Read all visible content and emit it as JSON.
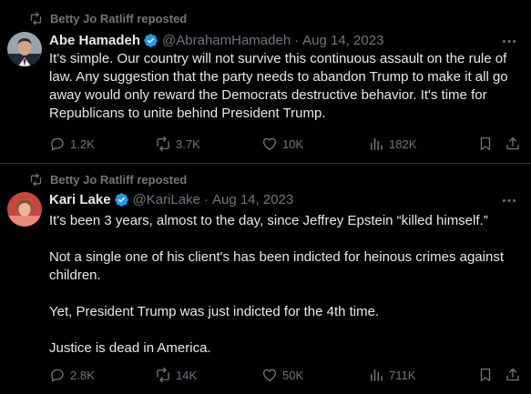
{
  "colors": {
    "background": "#000000",
    "text": "#e7e9ea",
    "muted": "#71767b",
    "verified_badge": "#1d9bf0",
    "divider": "#2f3336"
  },
  "tweets": [
    {
      "repost_label": "Betty Jo Ratliff reposted",
      "author_name": "Abe Hamadeh",
      "handle": "@AbrahamHamadeh",
      "separator": "·",
      "date": "Aug 14, 2023",
      "paragraphs": [
        "It's simple. Our country will not survive this continuous assault on the rule of law. Any suggestion that the party needs to abandon Trump to make it all go away would only reward the Democrats destructive behavior. It's time for Republicans to unite behind President Trump."
      ],
      "stats": {
        "replies": "1.2K",
        "reposts": "3.7K",
        "likes": "10K",
        "views": "182K"
      },
      "icons": [
        "repost-icon",
        "verified-badge-icon",
        "more-options-icon",
        "reply-icon",
        "repost-icon",
        "like-icon",
        "views-icon",
        "bookmark-icon",
        "share-icon"
      ]
    },
    {
      "repost_label": "Betty Jo Ratliff reposted",
      "author_name": "Kari Lake",
      "handle": "@KariLake",
      "separator": "·",
      "date": "Aug 14, 2023",
      "paragraphs": [
        "It's been 3 years, almost to the day, since Jeffrey Epstein “killed himself.”",
        "Not a single one of his client's has been indicted for heinous crimes against children.",
        "Yet, President Trump was just indicted for the 4th time.",
        "Justice is dead in America."
      ],
      "stats": {
        "replies": "2.8K",
        "reposts": "14K",
        "likes": "50K",
        "views": "711K"
      },
      "icons": [
        "repost-icon",
        "verified-badge-icon",
        "more-options-icon",
        "reply-icon",
        "repost-icon",
        "like-icon",
        "views-icon",
        "bookmark-icon",
        "share-icon"
      ]
    }
  ]
}
